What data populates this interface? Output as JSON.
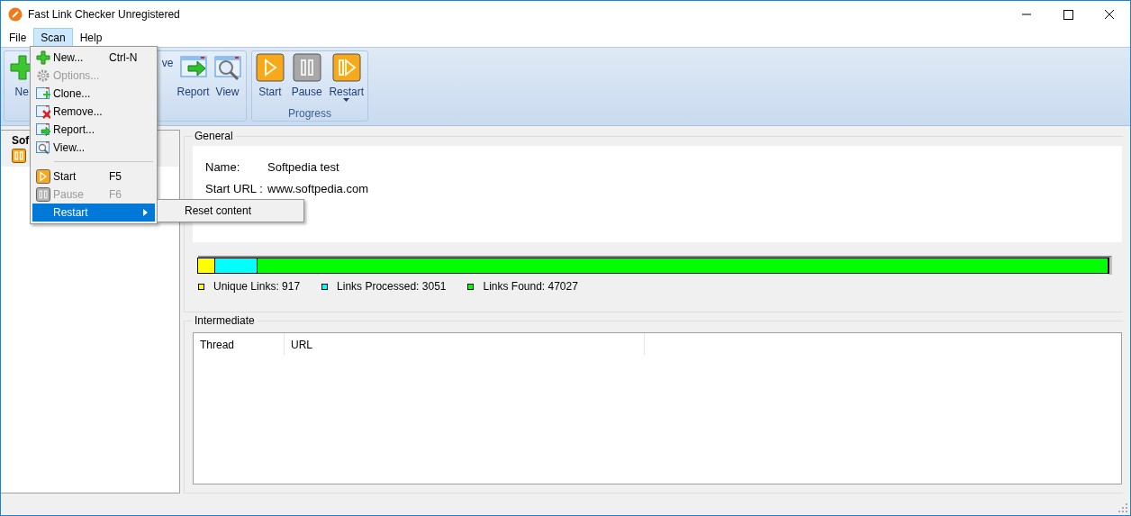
{
  "window": {
    "title": "Fast Link Checker Unregistered"
  },
  "menubar": [
    {
      "label": "File",
      "selected": false
    },
    {
      "label": "Scan",
      "selected": true
    },
    {
      "label": "Help",
      "selected": false
    }
  ],
  "toolbar": {
    "groups": [
      {
        "buttons": [
          {
            "label": "Ne",
            "kind": "new"
          },
          {
            "label": "ve",
            "kind": "remove"
          },
          {
            "label": "Report",
            "kind": "report"
          },
          {
            "label": "View",
            "kind": "view"
          }
        ]
      },
      {
        "label": "Progress",
        "buttons": [
          {
            "label": "Start",
            "kind": "start"
          },
          {
            "label": "Pause",
            "kind": "pause"
          },
          {
            "label": "Restart",
            "kind": "restart",
            "dropdown": true
          }
        ]
      }
    ]
  },
  "sidebar": {
    "items": [
      {
        "label": "Sof"
      }
    ]
  },
  "general": {
    "title": "General",
    "fields": [
      {
        "label": "Name:",
        "value": "Softpedia test"
      },
      {
        "label": "Start URL :",
        "value": "www.softpedia.com"
      }
    ],
    "segments": [
      {
        "color": "#ffff00",
        "level": 0.019
      },
      {
        "color": "#00ffff",
        "level": 0.065
      },
      {
        "color": "#00ff00",
        "level": 1
      }
    ],
    "legend": [
      {
        "label": "Unique Links: 917",
        "color": "#ffff00"
      },
      {
        "label": "Links Processed: 3051",
        "color": "#00ffff"
      },
      {
        "label": "Links Found: 47027",
        "color": "#00ff00"
      }
    ]
  },
  "intermediate": {
    "title": "Intermediate",
    "columns": [
      "Thread",
      "URL"
    ]
  },
  "menu": {
    "items": [
      {
        "kind": "item",
        "label": "New...",
        "shortcut": "Ctrl-N",
        "disabled": false,
        "selected": false
      },
      {
        "kind": "item",
        "label": "Options...",
        "disabled": true,
        "selected": false
      },
      {
        "kind": "item",
        "label": "Clone...",
        "disabled": false,
        "selected": false
      },
      {
        "kind": "item",
        "label": "Remove...",
        "disabled": false,
        "selected": false
      },
      {
        "kind": "item",
        "label": "Report...",
        "disabled": false,
        "selected": false
      },
      {
        "kind": "item",
        "label": "View...",
        "disabled": false,
        "selected": false
      },
      {
        "kind": "separator"
      },
      {
        "kind": "item",
        "label": "Start",
        "shortcut": "F5",
        "disabled": false,
        "selected": false
      },
      {
        "kind": "item",
        "label": "Pause",
        "shortcut": "F6",
        "disabled": true,
        "selected": false
      },
      {
        "kind": "submenu",
        "label": "Restart",
        "disabled": false,
        "selected": true
      }
    ],
    "submenu": [
      {
        "label": "Reset content"
      }
    ]
  }
}
